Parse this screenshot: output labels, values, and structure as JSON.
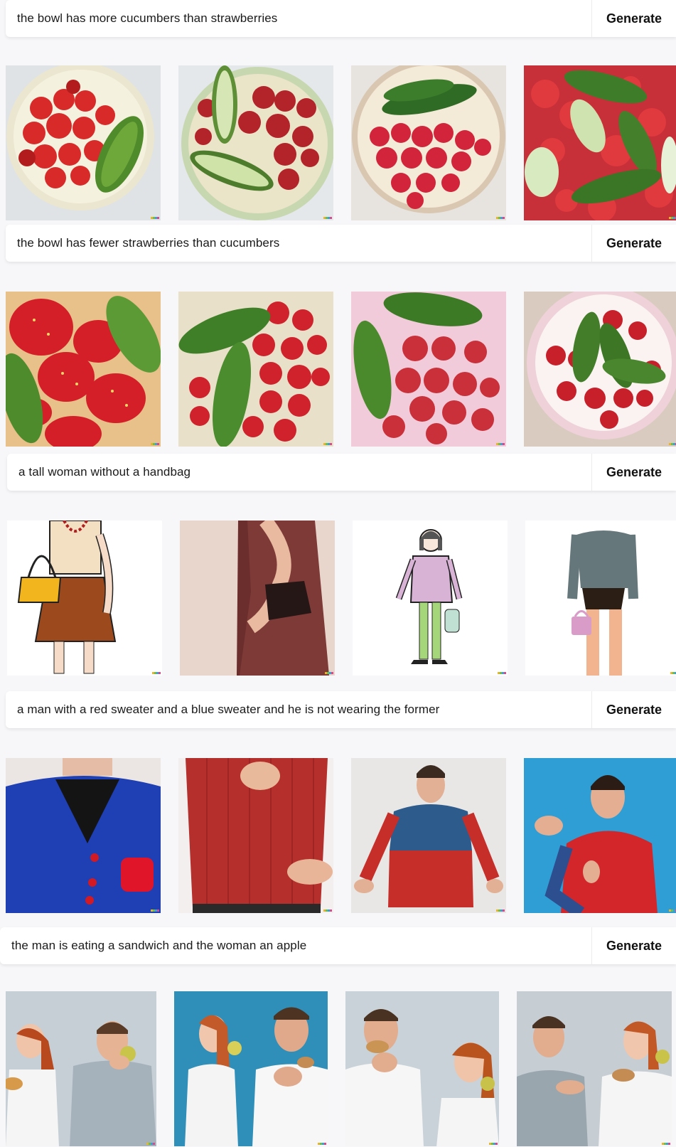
{
  "generate_label": "Generate",
  "sections": [
    {
      "prompt": "the bowl has more cucumbers than strawberries",
      "images": [
        {
          "alt": "strawberries bowl with one cucumber"
        },
        {
          "alt": "bowl with cucumber halves and strawberries"
        },
        {
          "alt": "bowl with two cucumbers and strawberries"
        },
        {
          "alt": "cucumbers and strawberries mixed"
        }
      ]
    },
    {
      "prompt": "the bowl has fewer strawberries than cucumbers",
      "images": [
        {
          "alt": "strawberries and cucumbers close-up"
        },
        {
          "alt": "two cucumbers over strawberries"
        },
        {
          "alt": "cucumbers with strawberries pile"
        },
        {
          "alt": "bowl with cucumbers and strawberries"
        }
      ]
    },
    {
      "prompt": "a tall woman without a handbag",
      "images": [
        {
          "alt": "cartoon woman with yellow handbag"
        },
        {
          "alt": "woman in red dress with bag"
        },
        {
          "alt": "illustration of woman with small bag"
        },
        {
          "alt": "torso with pink handbag"
        }
      ]
    },
    {
      "prompt": "a man with a red sweater and a blue sweater and he is not wearing the former",
      "images": [
        {
          "alt": "man in blue cardigan"
        },
        {
          "alt": "red knit sweater"
        },
        {
          "alt": "man in blue and red sweater"
        },
        {
          "alt": "man in red sweater with blue sleeves"
        }
      ]
    },
    {
      "prompt": "the man is eating a sandwich and the woman an apple",
      "images": [
        {
          "alt": "woman and man eating"
        },
        {
          "alt": "woman with apple, man with sandwich"
        },
        {
          "alt": "man eating sandwich, woman with apple"
        },
        {
          "alt": "man and woman eating"
        }
      ]
    }
  ]
}
